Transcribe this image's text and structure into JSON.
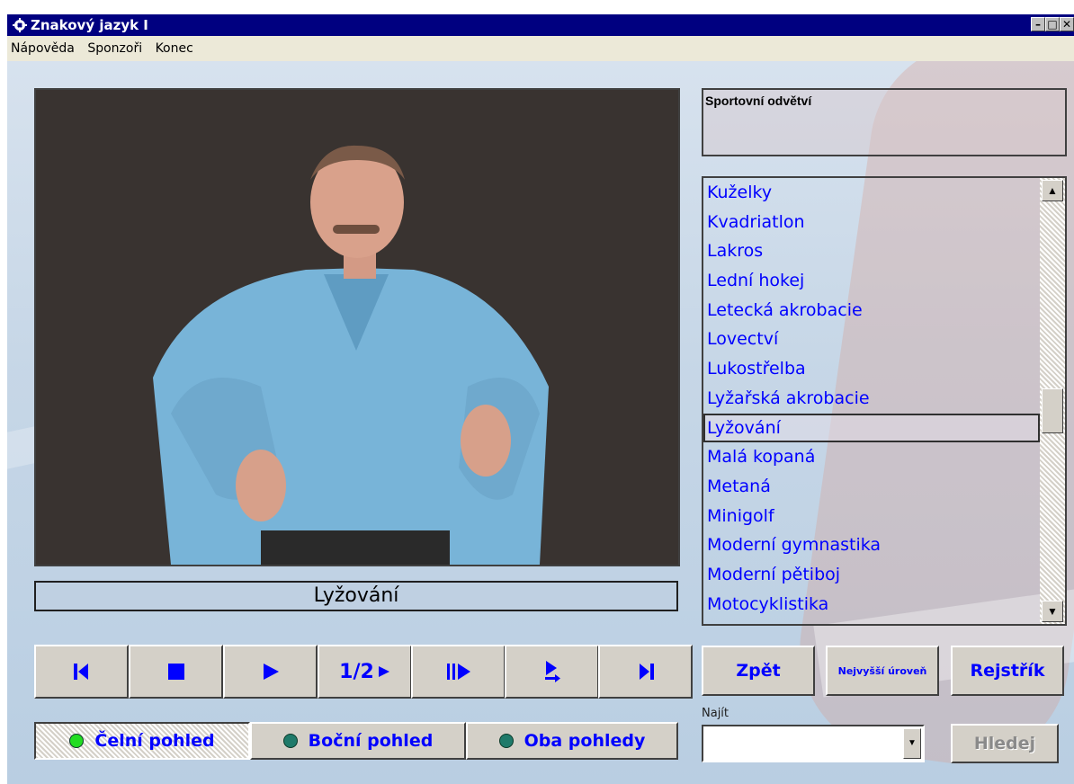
{
  "window": {
    "title": "Znakový jazyk I"
  },
  "menu": [
    "Nápověda",
    "Sponzoři",
    "Konec"
  ],
  "video": {
    "caption": "Lyžování"
  },
  "controls": [
    {
      "name": "first-button",
      "icon": "skip-first-icon",
      "label": ""
    },
    {
      "name": "stop-button",
      "icon": "stop-icon",
      "label": ""
    },
    {
      "name": "play-button",
      "icon": "play-icon",
      "label": ""
    },
    {
      "name": "half-speed-button",
      "icon": "play-icon",
      "label": "1/2"
    },
    {
      "name": "step-forward-button",
      "icon": "step-forward-icon",
      "label": ""
    },
    {
      "name": "next-step-button",
      "icon": "next-arrow-icon",
      "label": ""
    },
    {
      "name": "last-button",
      "icon": "skip-last-icon",
      "label": ""
    }
  ],
  "views": [
    {
      "label": "Čelní pohled",
      "active": true
    },
    {
      "label": "Boční pohled",
      "active": false
    },
    {
      "label": "Oba pohledy",
      "active": false
    }
  ],
  "category": {
    "title": "Sportovní odvětví"
  },
  "list": {
    "items": [
      "Kuželky",
      "Kvadriatlon",
      "Lakros",
      "Lední hokej",
      "Letecká akrobacie",
      "Lovectví",
      "Lukostřelba",
      "Lyžařská akrobacie",
      "Lyžování",
      "Malá kopaná",
      "Metaná",
      "Minigolf",
      "Moderní gymnastika",
      "Moderní pětiboj",
      "Motocyklistika"
    ],
    "selected_index": 8,
    "scroll_position": 0.55
  },
  "nav": {
    "back": "Zpět",
    "top": "Nejvyšší úroveň",
    "index": "Rejstřík"
  },
  "find": {
    "label": "Najít",
    "value": "",
    "button": "Hledej"
  },
  "colors": {
    "accent": "#0000ff",
    "titlebar": "#000080",
    "button_face": "#d4d0c8"
  }
}
